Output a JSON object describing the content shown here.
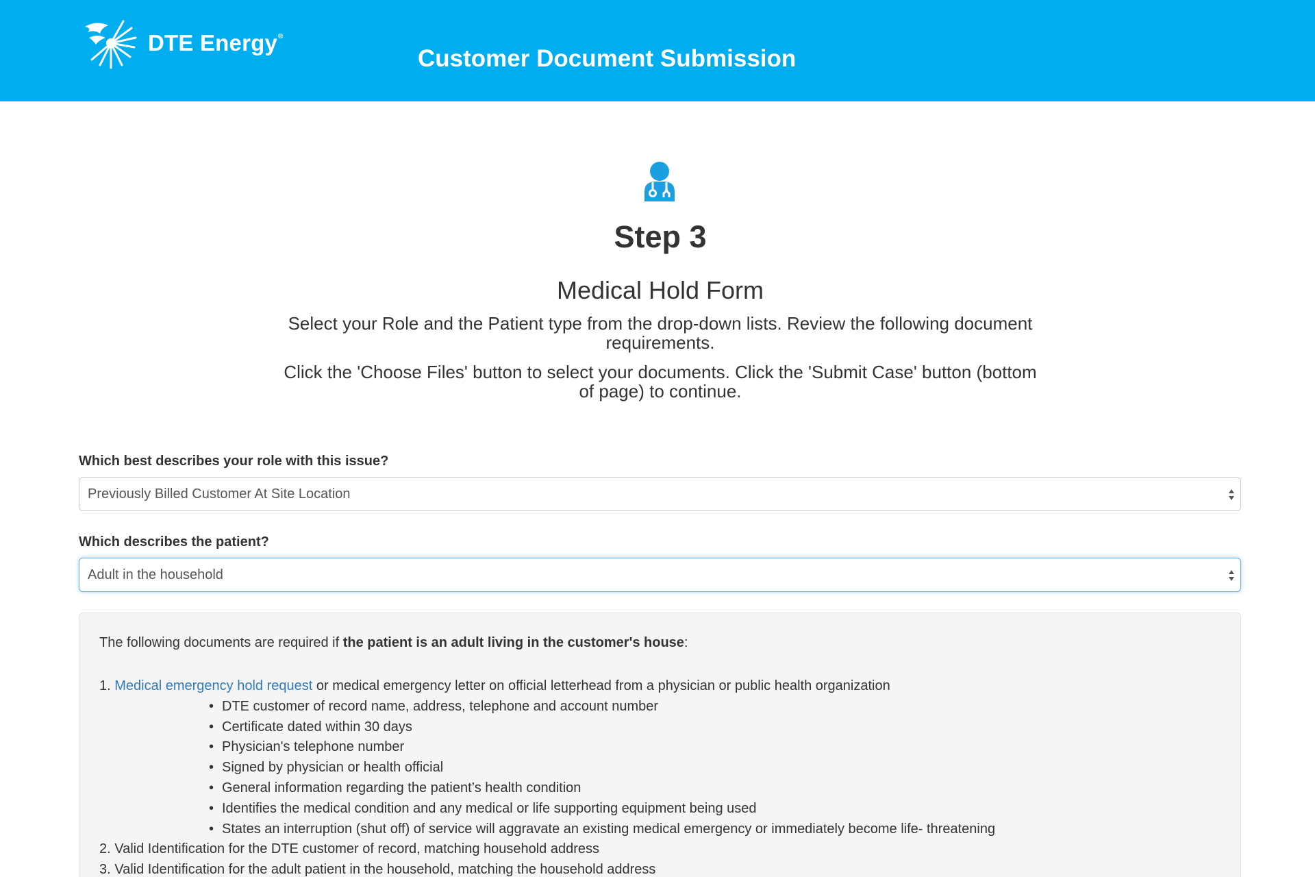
{
  "header": {
    "logo_text": "DTE Energy",
    "logo_mark": "®",
    "title": "Customer Document Submission"
  },
  "main": {
    "icon": "doctor-icon",
    "step_title": "Step 3",
    "form_title": "Medical Hold Form",
    "instructions_1": "Select your Role and the Patient type from the drop-down lists. Review the following document requirements.",
    "instructions_2": "Click the 'Choose Files' button to select your documents. Click the 'Submit Case' button (bottom of page) to continue."
  },
  "form": {
    "role_label": "Which best describes your role with this issue?",
    "role_value": "Previously Billed Customer At Site Location",
    "patient_label": "Which describes the patient?",
    "patient_value": "Adult in the household"
  },
  "requirements": {
    "intro_prefix": "The following documents are required if ",
    "intro_bold": "the patient is an adult living in the customer's house",
    "intro_suffix": ":",
    "item1_number": "1.",
    "item1_link": "Medical emergency hold request",
    "item1_text": " or medical emergency letter on official letterhead from a physician or public health organization",
    "item1_details": [
      "DTE customer of record name, address, telephone and account number",
      "Certificate dated within 30 days",
      "Physician's telephone number",
      "Signed by physician or health official",
      "General information regarding the patient’s health condition",
      "Identifies the medical condition and any medical or life supporting equipment being used",
      "States an interruption (shut off) of service will aggravate an existing medical emergency or immediately become life- threatening"
    ],
    "item2": "2. Valid Identification for the DTE customer of record, matching household address",
    "item3": "3. Valid Identification for the adult patient in the household, matching the household address"
  },
  "colors": {
    "header_bg": "#00adef",
    "accent": "#1a9fe0",
    "link": "#337ab7",
    "panel_bg": "#f5f5f5"
  }
}
